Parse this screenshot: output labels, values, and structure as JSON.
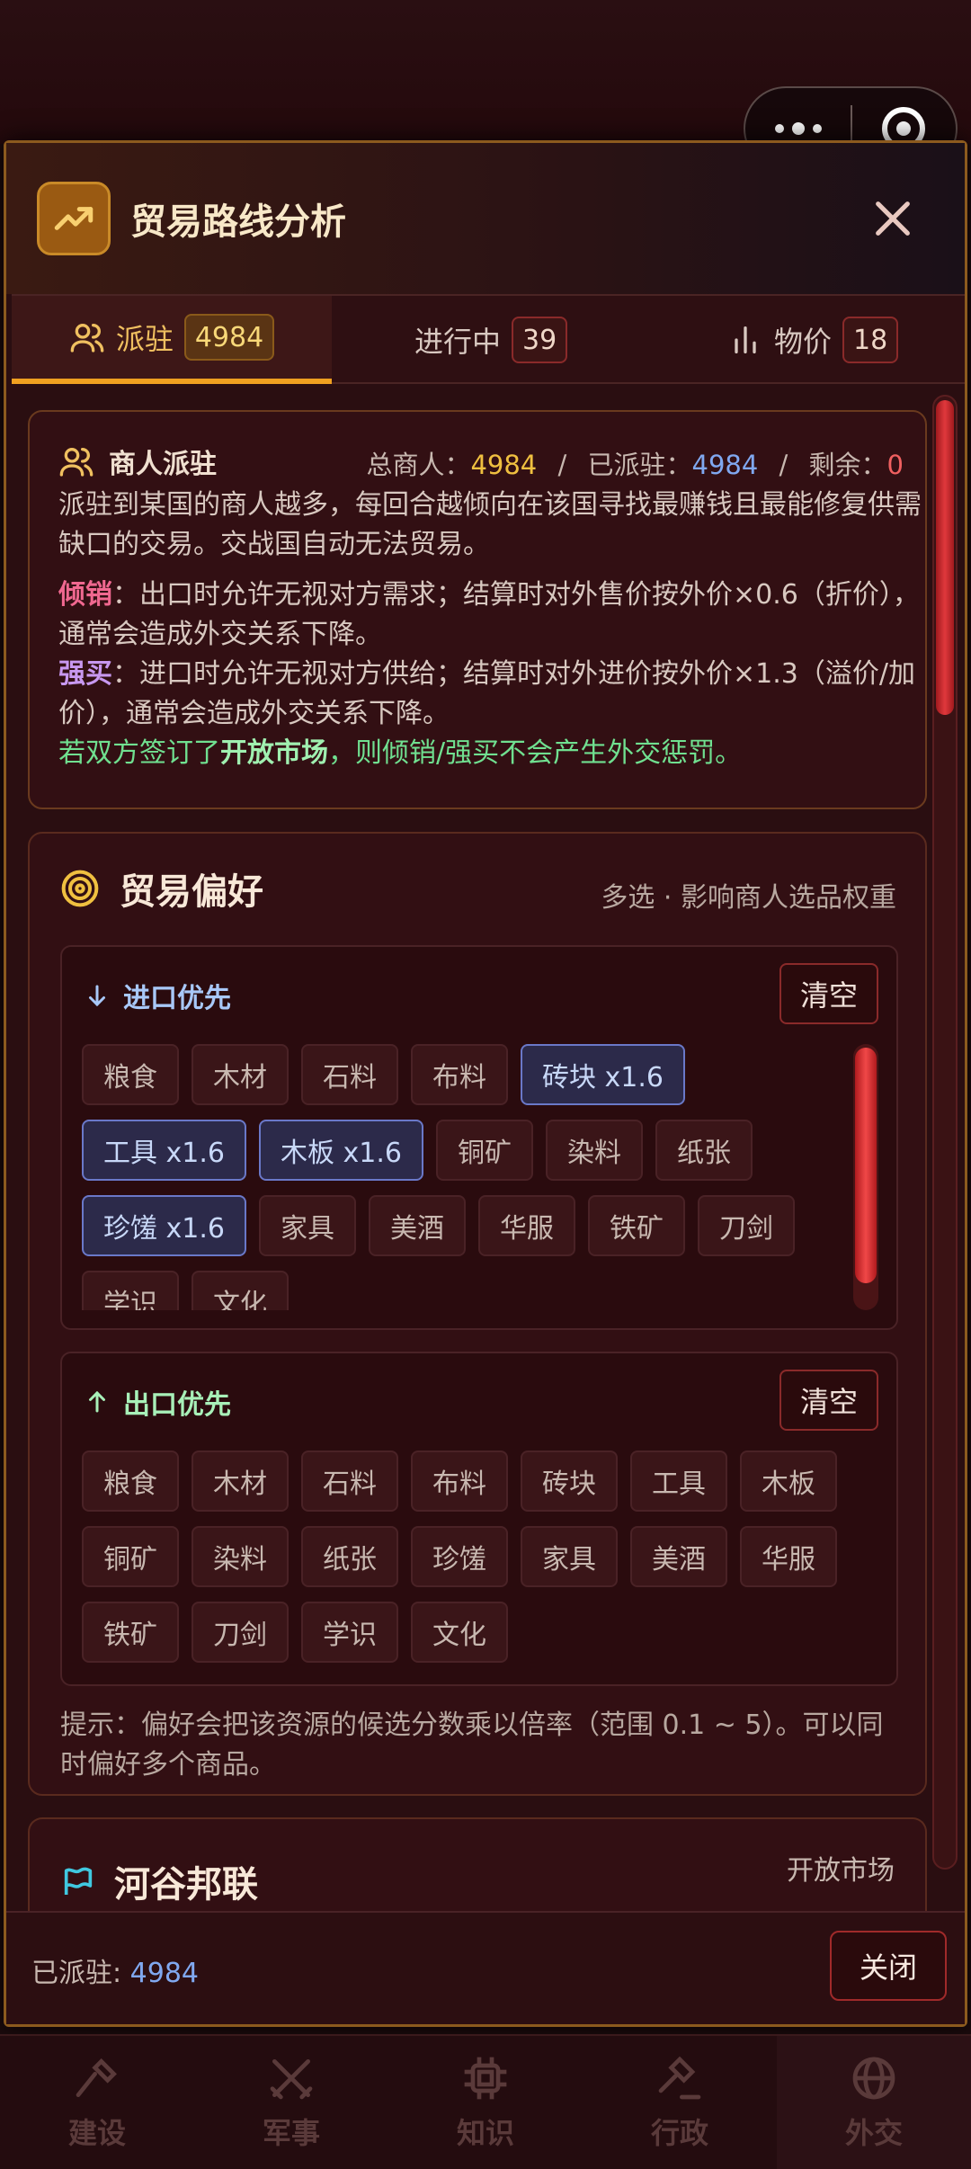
{
  "capsule": {
    "more_icon": "more-dots-icon",
    "target_icon": "target-circle-icon"
  },
  "dialog": {
    "title": "贸易路线分析",
    "close_icon": "close-icon"
  },
  "tabs": [
    {
      "label": "派驻",
      "count": "4984",
      "icon": "users-icon",
      "active": true
    },
    {
      "label": "进行中",
      "count": "39",
      "active": false
    },
    {
      "label": "物价",
      "count": "18",
      "icon": "bar-chart-icon",
      "active": false
    }
  ],
  "merchant": {
    "title": "商人派驻",
    "total_label": "总商人：",
    "total_value": "4984",
    "sep1": "/",
    "deployed_label": "已派驻：",
    "deployed_value": "4984",
    "sep2": "/",
    "remaining_label": "剩余：",
    "remaining_value": "0",
    "desc": "派驻到某国的商人越多，每回合越倾向在该国寻找最赚钱且最能修复供需缺口的交易。交战国自动无法贸易。",
    "dump_term": "倾销",
    "dump_desc": "：出口时允许无视对方需求；结算时对外售价按外价×0.6（折价），通常会造成外交关系下降。",
    "force_term": "强买",
    "force_desc": "：进口时允许无视对方供给；结算时对外进价按外价×1.3（溢价/加价），通常会造成外交关系下降。",
    "open_pre": "若双方签订了",
    "open_term": "开放市场",
    "open_post": "，则倾销/强买不会产生外交惩罚。"
  },
  "preference": {
    "title": "贸易偏好",
    "subtitle": "多选 · 影响商人选品权重",
    "import": {
      "title": "进口优先",
      "clear": "清空",
      "items": [
        {
          "label": "粮食",
          "selected": false
        },
        {
          "label": "木材",
          "selected": false
        },
        {
          "label": "石料",
          "selected": false
        },
        {
          "label": "布料",
          "selected": false
        },
        {
          "label": "砖块 x1.6",
          "selected": true
        },
        {
          "label": "工具 x1.6",
          "selected": true
        },
        {
          "label": "木板 x1.6",
          "selected": true
        },
        {
          "label": "铜矿",
          "selected": false
        },
        {
          "label": "染料",
          "selected": false
        },
        {
          "label": "纸张",
          "selected": false
        },
        {
          "label": "珍馐 x1.6",
          "selected": true
        },
        {
          "label": "家具",
          "selected": false
        },
        {
          "label": "美酒",
          "selected": false
        },
        {
          "label": "华服",
          "selected": false
        },
        {
          "label": "铁矿",
          "selected": false
        },
        {
          "label": "刀剑",
          "selected": false
        },
        {
          "label": "学识",
          "selected": false
        },
        {
          "label": "文化",
          "selected": false
        }
      ]
    },
    "export": {
      "title": "出口优先",
      "clear": "清空",
      "items": [
        "粮食",
        "木材",
        "石料",
        "布料",
        "砖块",
        "工具",
        "木板",
        "铜矿",
        "染料",
        "纸张",
        "珍馐",
        "家具",
        "美酒",
        "华服",
        "铁矿",
        "刀剑",
        "学识",
        "文化"
      ]
    },
    "tip": "提示：偏好会把该资源的候选分数乘以倍率（范围 0.1 ~ 5）。可以同时偏好多个商品。"
  },
  "nation": {
    "name": "河谷邦联",
    "status": "开放市场",
    "icon": "flag-icon"
  },
  "footer": {
    "deployed_label": "已派驻: ",
    "deployed_value": "4984",
    "close": "关闭"
  },
  "bottom_nav": [
    {
      "label": "建设",
      "icon": "hammer-icon"
    },
    {
      "label": "军事",
      "icon": "crossed-swords-icon"
    },
    {
      "label": "知识",
      "icon": "chip-icon"
    },
    {
      "label": "行政",
      "icon": "gavel-icon"
    },
    {
      "label": "外交",
      "icon": "globe-icon"
    }
  ],
  "colors": {
    "accent": "#f0a020",
    "selected_chip": "#6a78c8",
    "danger": "#a02a2a"
  }
}
